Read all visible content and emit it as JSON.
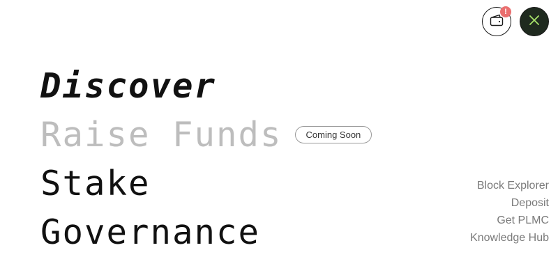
{
  "header": {
    "wallet_icon": "wallet-icon",
    "alert_badge": "!",
    "close_icon": "close-icon",
    "close_icon_color": "#a8e36a"
  },
  "nav": {
    "items": [
      {
        "label": "Discover",
        "state": "active"
      },
      {
        "label": "Raise Funds",
        "state": "disabled",
        "badge": "Coming Soon"
      },
      {
        "label": "Stake",
        "state": "normal"
      },
      {
        "label": "Governance",
        "state": "normal"
      }
    ]
  },
  "links": [
    "Block Explorer",
    "Deposit",
    "Get PLMC",
    "Knowledge Hub"
  ],
  "colors": {
    "background": "#ffffff",
    "text": "#111111",
    "disabled_text": "#bdbdbd",
    "link_text": "#7a7a7a",
    "badge_red": "#ea6f6f",
    "close_bg": "#1f2a1f"
  }
}
